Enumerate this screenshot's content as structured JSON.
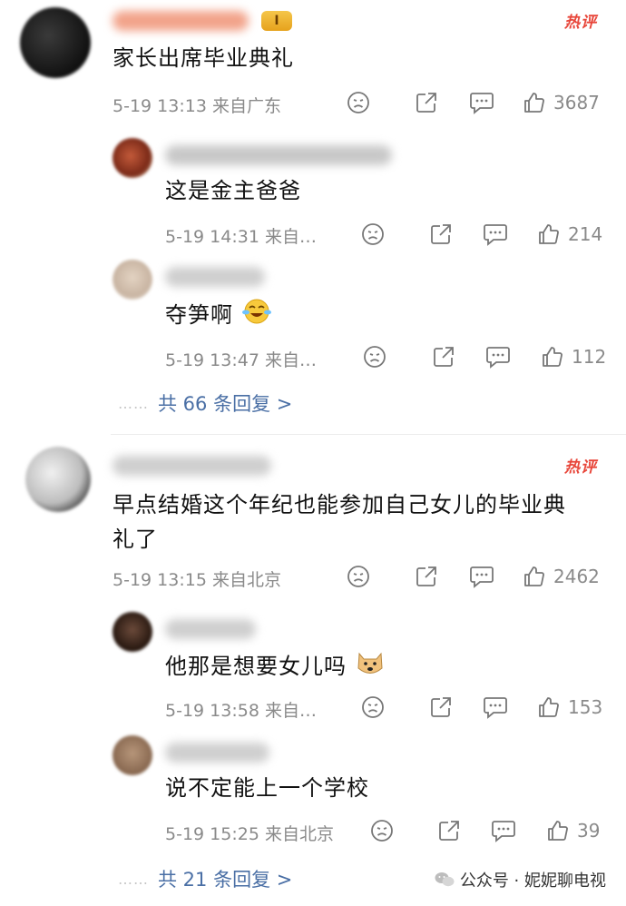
{
  "comments": [
    {
      "text": "家长出席毕业典礼",
      "badge": "热评",
      "level": "I",
      "meta": "5-19 13:13 来自广东",
      "likes": "3687",
      "replies": [
        {
          "text": "这是金主爸爸",
          "meta": "5-19 14:31 来自…",
          "likes": "214"
        },
        {
          "text": "夺笋啊",
          "meta": "5-19 13:47 来自…",
          "likes": "112"
        }
      ],
      "more_replies": "共 66 条回复 >"
    },
    {
      "text_line1": "早点结婚这个年纪也能参加自己女儿的毕业典",
      "text_line2": "礼了",
      "badge": "热评",
      "meta": "5-19 13:15 来自北京",
      "likes": "2462",
      "replies": [
        {
          "text": "他那是想要女儿吗",
          "meta": "5-19 13:58 来自…",
          "likes": "153"
        },
        {
          "text": "说不定能上一个学校",
          "meta": "5-19 15:25 来自北京",
          "likes": "39"
        }
      ],
      "more_replies": "共 21 条回复 >"
    }
  ],
  "more_dots": "……",
  "watermark": "公众号 · 妮妮聊电视"
}
